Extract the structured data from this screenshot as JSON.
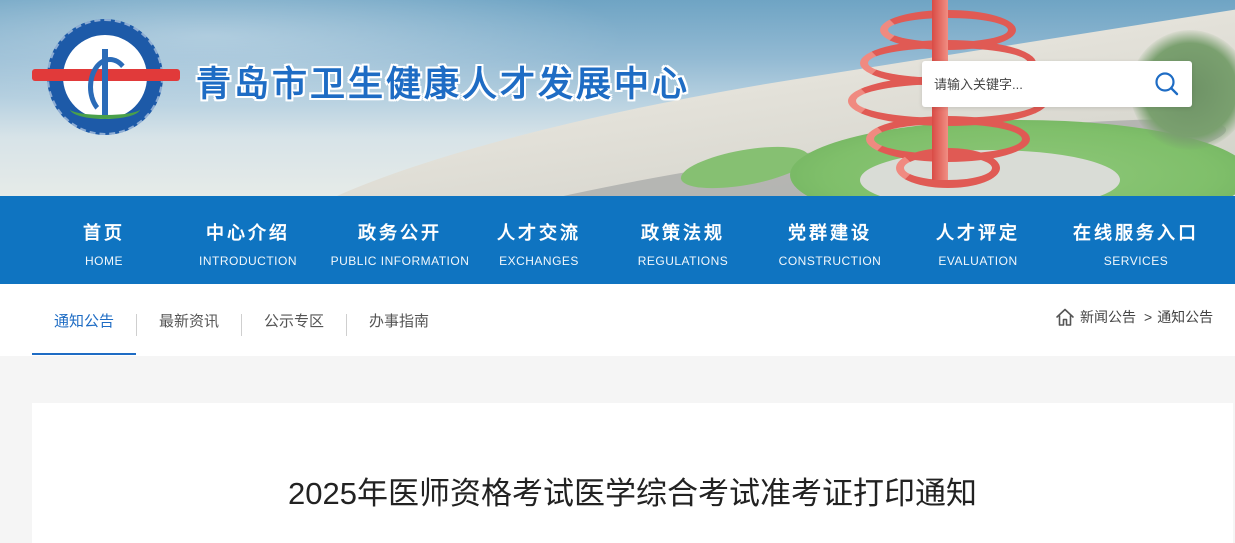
{
  "header": {
    "site_title": "青岛市卫生健康人才发展中心",
    "logo_icon": "qingdao-health-talent-logo",
    "search": {
      "placeholder": "请输入关键字...",
      "value": "",
      "icon": "search-icon"
    }
  },
  "nav": {
    "items": [
      {
        "zh": "首页",
        "en": "HOME"
      },
      {
        "zh": "中心介绍",
        "en": "INTRODUCTION"
      },
      {
        "zh": "政务公开",
        "en": "PUBLIC INFORMATION"
      },
      {
        "zh": "人才交流",
        "en": "EXCHANGES"
      },
      {
        "zh": "政策法规",
        "en": "REGULATIONS"
      },
      {
        "zh": "党群建设",
        "en": "CONSTRUCTION"
      },
      {
        "zh": "人才评定",
        "en": "EVALUATION"
      },
      {
        "zh": "在线服务入口",
        "en": "SERVICES"
      }
    ]
  },
  "subnav": {
    "tabs": [
      {
        "label": "通知公告",
        "active": true
      },
      {
        "label": "最新资讯",
        "active": false
      },
      {
        "label": "公示专区",
        "active": false
      },
      {
        "label": "办事指南",
        "active": false
      }
    ]
  },
  "breadcrumb": {
    "home_icon": "home-icon",
    "items": [
      "新闻公告",
      "通知公告"
    ],
    "separator": ">"
  },
  "article": {
    "title": "2025年医师资格考试医学综合考试准考证打印通知"
  },
  "colors": {
    "nav_bg": "#0f74c1",
    "accent": "#1e6cc4",
    "page_bg": "#f5f5f5"
  }
}
